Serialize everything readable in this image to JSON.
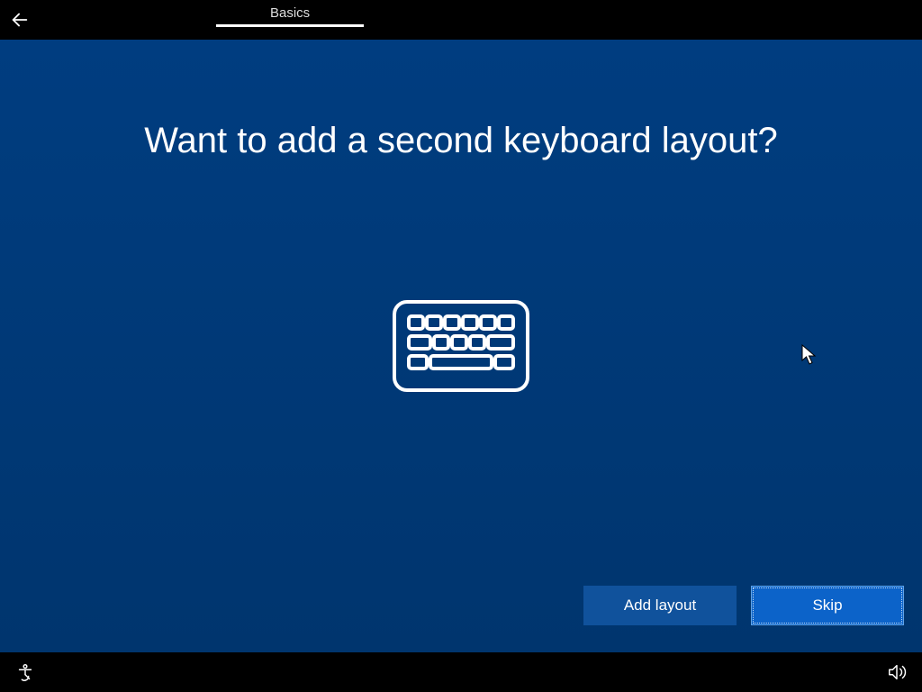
{
  "header": {
    "tab_label": "Basics"
  },
  "main": {
    "title": "Want to add a second keyboard layout?"
  },
  "buttons": {
    "add_layout": "Add layout",
    "skip": "Skip"
  }
}
